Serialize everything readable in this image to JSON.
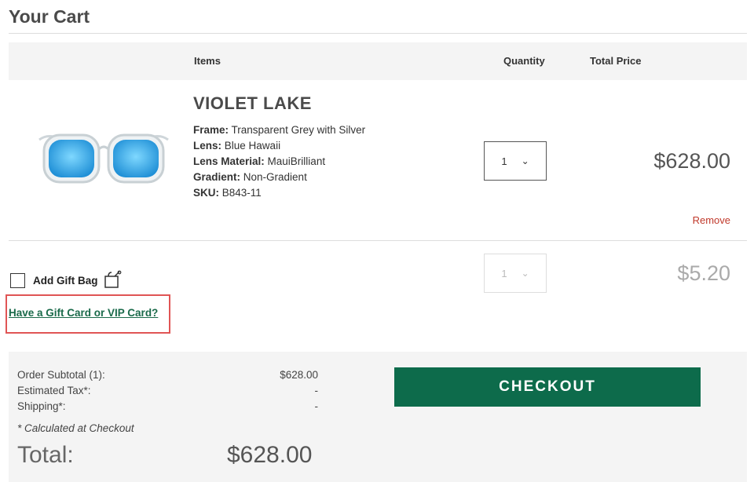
{
  "page": {
    "title": "Your Cart"
  },
  "table_header": {
    "items": "Items",
    "quantity": "Quantity",
    "total_price": "Total Price"
  },
  "product": {
    "name": "VIOLET LAKE",
    "attributes": [
      {
        "key": "Frame:",
        "value": "Transparent Grey with Silver"
      },
      {
        "key": "Lens:",
        "value": "Blue Hawaii"
      },
      {
        "key": "Lens Material:",
        "value": "MauiBrilliant"
      },
      {
        "key": "Gradient:",
        "value": "Non-Gradient"
      },
      {
        "key": "SKU:",
        "value": "B843-11"
      }
    ],
    "quantity": "1",
    "price": "$628.00",
    "remove_label": "Remove",
    "lens_color": "#2aa6e8"
  },
  "gift_bag": {
    "label": "Add Gift Bag",
    "quantity": "1",
    "price": "$5.20",
    "checked": false
  },
  "gift_card_link": "Have a Gift Card or VIP Card?",
  "summary": {
    "subtotal_label": "Order Subtotal (1):",
    "subtotal_value": "$628.00",
    "tax_label": "Estimated Tax*:",
    "tax_value": "-",
    "shipping_label": "Shipping*:",
    "shipping_value": "-",
    "note": "* Calculated at Checkout",
    "total_label": "Total:",
    "total_value": "$628.00"
  },
  "checkout_label": "CHECKOUT",
  "colors": {
    "checkout": "#0d6b4b",
    "remove": "#c0392b",
    "highlight_box": "#e05555",
    "link": "#1a6a4a"
  }
}
